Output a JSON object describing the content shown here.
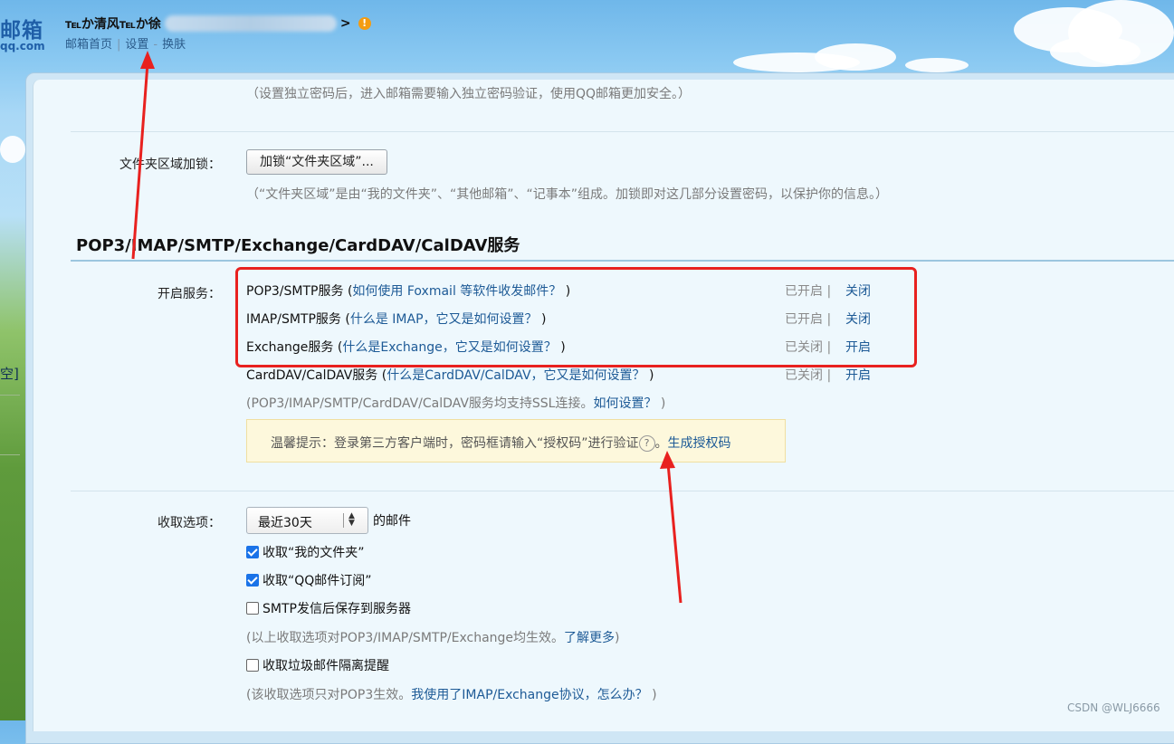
{
  "header": {
    "logo": "邮箱",
    "logo_sub": "qq.com",
    "user_prefix": "℡か清风℡か徐",
    "user_suffix": ">",
    "nav": {
      "home": "邮箱首页",
      "sep": "|",
      "settings": "设置",
      "dash": "-",
      "skin": "换肤"
    }
  },
  "left_strip": {
    "text": "空]"
  },
  "security": {
    "pwd_hint": "（设置独立密码后，进入邮箱需要输入独立密码验证，使用QQ邮箱更加安全。）",
    "folder_lock_label": "文件夹区域加锁：",
    "folder_lock_button": "加锁“文件夹区域”...",
    "folder_lock_hint": "（“文件夹区域”是由“我的文件夹”、“其他邮箱”、“记事本”组成。加锁即对这几部分设置密码，以保护你的信息。）"
  },
  "services": {
    "title": "POP3/IMAP/SMTP/Exchange/CardDAV/CalDAV服务",
    "label": "开启服务：",
    "items": [
      {
        "name": "POP3/SMTP服务",
        "open": " (",
        "link": "如何使用 Foxmail 等软件收发邮件？",
        "close": " )",
        "status": "已开启 |",
        "action": "关闭"
      },
      {
        "name": "IMAP/SMTP服务",
        "open": " (",
        "link": "什么是 IMAP，它又是如何设置？",
        "close": " )",
        "status": "已开启 |",
        "action": "关闭"
      },
      {
        "name": "Exchange服务",
        "open": " (",
        "link": "什么是Exchange，它又是如何设置？",
        "close": " )",
        "status": "已关闭 |",
        "action": "开启"
      },
      {
        "name": "CardDAV/CalDAV服务",
        "open": " (",
        "link": "什么是CardDAV/CalDAV，它又是如何设置？",
        "close": " )",
        "status": "已关闭 |",
        "action": "开启"
      }
    ],
    "ssl_hint": "(POP3/IMAP/SMTP/CardDAV/CalDAV服务均支持SSL连接。",
    "ssl_link": "如何设置？",
    "ssl_close": " )",
    "tip_text": "温馨提示：登录第三方客户端时，密码框请输入“授权码”进行验证",
    "tip_q": "?",
    "tip_dot": "。",
    "tip_link": "生成授权码"
  },
  "receive": {
    "label": "收取选项：",
    "select_value": "最近30天",
    "select_suffix": "的邮件",
    "options": [
      {
        "label": "收取“我的文件夹”",
        "checked": true
      },
      {
        "label": "收取“QQ邮件订阅”",
        "checked": true
      },
      {
        "label": "SMTP发信后保存到服务器",
        "checked": false
      }
    ],
    "hint1": "(以上收取选项对POP3/IMAP/SMTP/Exchange均生效。",
    "hint1_link": "了解更多",
    "hint1_close": ")",
    "spam_option": {
      "label": "收取垃圾邮件隔离提醒",
      "checked": false
    },
    "hint2": "(该收取选项只对POP3生效。",
    "hint2_link": "我使用了IMAP/Exchange协议，怎么办？",
    "hint2_close": " )"
  },
  "watermark": "CSDN @WLJ6666",
  "colors": {
    "link": "#1d5a96",
    "annotation": "#e8211f",
    "checkbox": "#1a73e8",
    "tip_bg": "#fdf8dc"
  }
}
